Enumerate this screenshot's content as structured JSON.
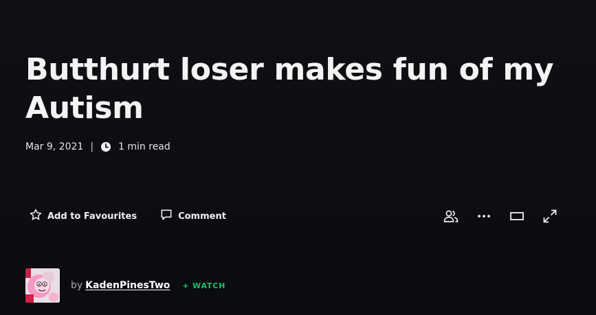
{
  "deviation": {
    "title": "Butthurt loser makes fun of my Autism",
    "date": "Mar 9, 2021",
    "separator": "|",
    "read_time": "1 min read"
  },
  "actions": {
    "favourite_label": "Add to Favourites",
    "comment_label": "Comment"
  },
  "tools": [
    "people-icon",
    "more-icon",
    "theater-mode-icon",
    "expand-icon"
  ],
  "author": {
    "by_label": "by",
    "username": "KadenPinesTwo",
    "watch_label": "+ WATCH"
  },
  "colors": {
    "background": "#0c0e12",
    "watch_green": "#1ec06f",
    "text": "#f2f2f2"
  }
}
